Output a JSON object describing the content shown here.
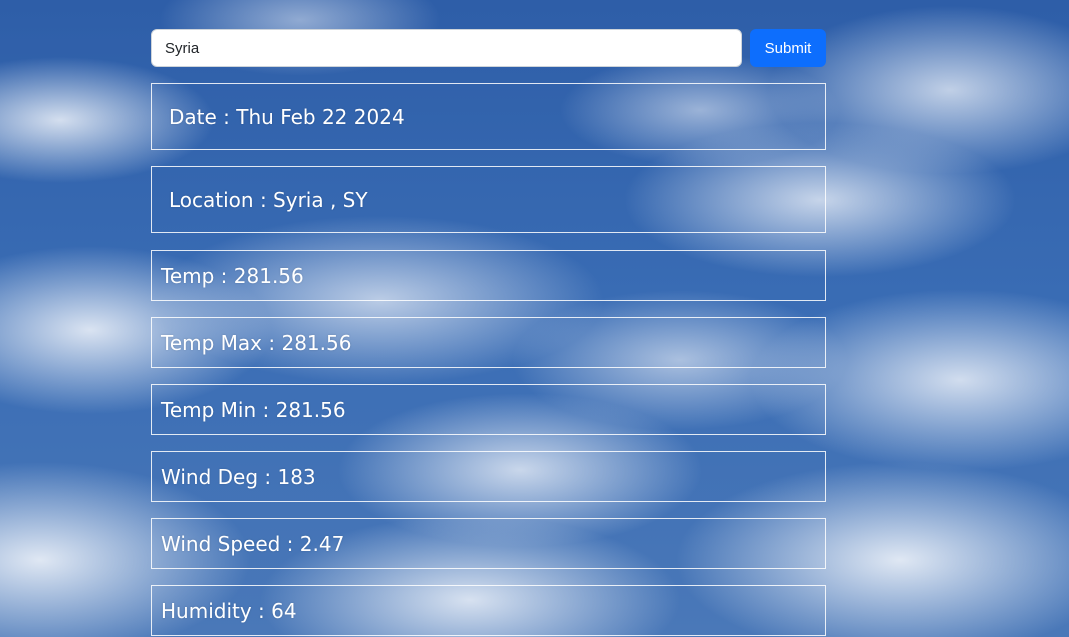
{
  "search": {
    "value": "Syria",
    "submit_label": "Submit"
  },
  "date": {
    "label": "Date",
    "value": "Thu Feb 22 2024"
  },
  "location": {
    "label": "Location",
    "value": "Syria , SY"
  },
  "stats": [
    {
      "label": "Temp",
      "value": "281.56"
    },
    {
      "label": "Temp Max",
      "value": "281.56"
    },
    {
      "label": "Temp Min",
      "value": "281.56"
    },
    {
      "label": "Wind Deg",
      "value": "183"
    },
    {
      "label": "Wind Speed",
      "value": "2.47"
    },
    {
      "label": "Humidity",
      "value": "64"
    }
  ],
  "colors": {
    "submit_bg": "#0d6efd",
    "card_text": "#ffffff"
  }
}
